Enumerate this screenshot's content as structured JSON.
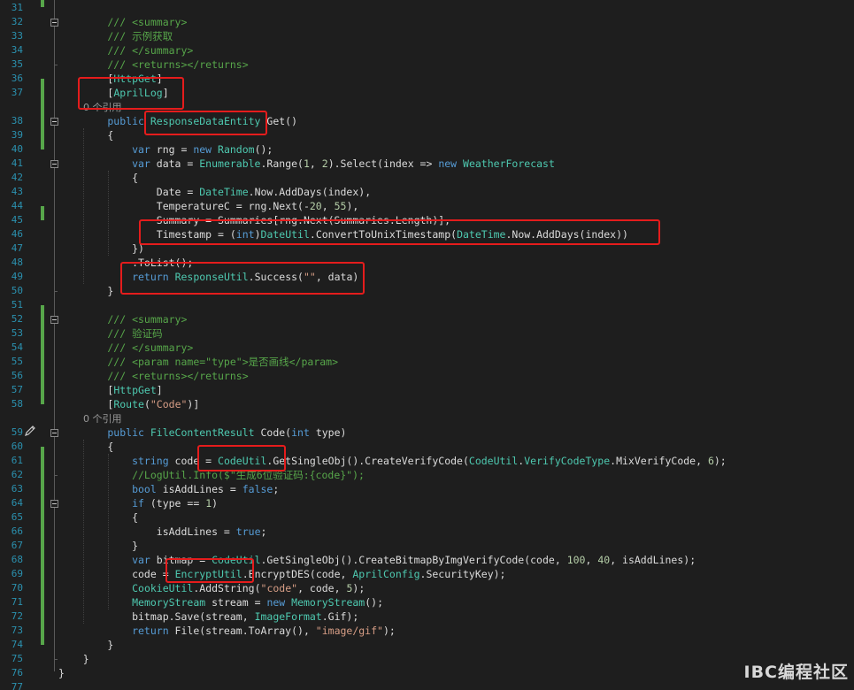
{
  "editor": {
    "lines": [
      {
        "n": "31",
        "segs": []
      },
      {
        "n": "32",
        "segs": [
          [
            "cm",
            "        /// <summary>"
          ]
        ]
      },
      {
        "n": "33",
        "segs": [
          [
            "cm",
            "        /// 示例获取"
          ]
        ]
      },
      {
        "n": "34",
        "segs": [
          [
            "cm",
            "        /// </summary>"
          ]
        ]
      },
      {
        "n": "35",
        "segs": [
          [
            "cm",
            "        /// <returns></returns>"
          ]
        ]
      },
      {
        "n": "36",
        "segs": [
          [
            "",
            "        ["
          ],
          [
            "attr",
            "HttpGet"
          ],
          [
            "",
            "]"
          ]
        ]
      },
      {
        "n": "37",
        "segs": [
          [
            "",
            "        ["
          ],
          [
            "attr",
            "AprilLog"
          ],
          [
            "",
            "]"
          ]
        ]
      },
      {
        "n": "",
        "segs": [
          [
            "ref",
            "        0 个引用"
          ]
        ]
      },
      {
        "n": "38",
        "segs": [
          [
            "kw",
            "        public "
          ],
          [
            "ty",
            "ResponseDataEntity"
          ],
          [
            "",
            " Get()"
          ]
        ]
      },
      {
        "n": "39",
        "segs": [
          [
            "",
            "        {"
          ]
        ]
      },
      {
        "n": "40",
        "segs": [
          [
            "kw",
            "            var"
          ],
          [
            "",
            " rng = "
          ],
          [
            "kw",
            "new "
          ],
          [
            "ty",
            "Random"
          ],
          [
            "",
            "();"
          ]
        ]
      },
      {
        "n": "41",
        "segs": [
          [
            "kw",
            "            var"
          ],
          [
            "",
            " data = "
          ],
          [
            "ty",
            "Enumerable"
          ],
          [
            "",
            ".Range("
          ],
          [
            "nm",
            "1"
          ],
          [
            "",
            ", "
          ],
          [
            "nm",
            "2"
          ],
          [
            "",
            ").Select(index => "
          ],
          [
            "kw",
            "new "
          ],
          [
            "ty",
            "WeatherForecast"
          ]
        ]
      },
      {
        "n": "42",
        "segs": [
          [
            "",
            "            {"
          ]
        ]
      },
      {
        "n": "43",
        "segs": [
          [
            "",
            "                Date = "
          ],
          [
            "ty",
            "DateTime"
          ],
          [
            "",
            ".Now.AddDays(index),"
          ]
        ]
      },
      {
        "n": "44",
        "segs": [
          [
            "",
            "                TemperatureC = rng.Next(-"
          ],
          [
            "nm",
            "20"
          ],
          [
            "",
            ", "
          ],
          [
            "nm",
            "55"
          ],
          [
            "",
            "),"
          ]
        ]
      },
      {
        "n": "45",
        "segs": [
          [
            "",
            "                Summary = Summaries[rng.Next(Summaries.Length)],"
          ]
        ]
      },
      {
        "n": "46",
        "segs": [
          [
            "",
            "                Timestamp = ("
          ],
          [
            "kw",
            "int"
          ],
          [
            "",
            ")"
          ],
          [
            "ty",
            "DateUtil"
          ],
          [
            "",
            ".ConvertToUnixTimestamp("
          ],
          [
            "ty",
            "DateTime"
          ],
          [
            "",
            ".Now.AddDays(index))"
          ]
        ]
      },
      {
        "n": "47",
        "segs": [
          [
            "",
            "            })"
          ]
        ]
      },
      {
        "n": "48",
        "segs": [
          [
            "",
            "            .ToList();"
          ]
        ]
      },
      {
        "n": "49",
        "segs": [
          [
            "kw",
            "            return "
          ],
          [
            "ty",
            "ResponseUtil"
          ],
          [
            "",
            ".Success("
          ],
          [
            "st",
            "\"\""
          ],
          [
            "",
            ", data)"
          ]
        ]
      },
      {
        "n": "50",
        "segs": [
          [
            "",
            "        }"
          ]
        ]
      },
      {
        "n": "51",
        "segs": []
      },
      {
        "n": "52",
        "segs": [
          [
            "cm",
            "        /// <summary>"
          ]
        ]
      },
      {
        "n": "53",
        "segs": [
          [
            "cm",
            "        /// 验证码"
          ]
        ]
      },
      {
        "n": "54",
        "segs": [
          [
            "cm",
            "        /// </summary>"
          ]
        ]
      },
      {
        "n": "55",
        "segs": [
          [
            "cm",
            "        /// <param name=\"type\">是否画线</param>"
          ]
        ]
      },
      {
        "n": "56",
        "segs": [
          [
            "cm",
            "        /// <returns></returns>"
          ]
        ]
      },
      {
        "n": "57",
        "segs": [
          [
            "",
            "        ["
          ],
          [
            "attr",
            "HttpGet"
          ],
          [
            "",
            "]"
          ]
        ]
      },
      {
        "n": "58",
        "segs": [
          [
            "",
            "        ["
          ],
          [
            "attr",
            "Route"
          ],
          [
            "",
            "("
          ],
          [
            "st",
            "\"Code\""
          ],
          [
            "",
            ")]"
          ]
        ]
      },
      {
        "n": "",
        "segs": [
          [
            "ref",
            "        0 个引用"
          ]
        ]
      },
      {
        "n": "59",
        "segs": [
          [
            "kw",
            "        public "
          ],
          [
            "ty",
            "FileContentResult"
          ],
          [
            "",
            " Code("
          ],
          [
            "kw",
            "int"
          ],
          [
            "",
            " type)"
          ]
        ]
      },
      {
        "n": "60",
        "segs": [
          [
            "",
            "        {"
          ]
        ]
      },
      {
        "n": "61",
        "segs": [
          [
            "kw",
            "            string"
          ],
          [
            "",
            " code = "
          ],
          [
            "ty",
            "CodeUtil"
          ],
          [
            "",
            ".GetSingleObj().CreateVerifyCode("
          ],
          [
            "ty",
            "CodeUtil"
          ],
          [
            "",
            "."
          ],
          [
            "ty",
            "VerifyCodeType"
          ],
          [
            "",
            ".MixVerifyCode, "
          ],
          [
            "nm",
            "6"
          ],
          [
            "",
            ");"
          ]
        ]
      },
      {
        "n": "62",
        "segs": [
          [
            "cm",
            "            //LogUtil.Info($\"生成6位验证码:{code}\");"
          ]
        ]
      },
      {
        "n": "63",
        "segs": [
          [
            "kw",
            "            bool"
          ],
          [
            "",
            " isAddLines = "
          ],
          [
            "kw",
            "false"
          ],
          [
            "",
            ";"
          ]
        ]
      },
      {
        "n": "64",
        "segs": [
          [
            "kw",
            "            if"
          ],
          [
            "",
            " (type == "
          ],
          [
            "nm",
            "1"
          ],
          [
            "",
            ")"
          ]
        ]
      },
      {
        "n": "65",
        "segs": [
          [
            "",
            "            {"
          ]
        ]
      },
      {
        "n": "66",
        "segs": [
          [
            "",
            "                isAddLines = "
          ],
          [
            "kw",
            "true"
          ],
          [
            "",
            ";"
          ]
        ]
      },
      {
        "n": "67",
        "segs": [
          [
            "",
            "            }"
          ]
        ]
      },
      {
        "n": "68",
        "segs": [
          [
            "kw",
            "            var"
          ],
          [
            "",
            " bitmap = "
          ],
          [
            "ty",
            "CodeUtil"
          ],
          [
            "",
            ".GetSingleObj().CreateBitmapByImgVerifyCode(code, "
          ],
          [
            "nm",
            "100"
          ],
          [
            "",
            ", "
          ],
          [
            "nm",
            "40"
          ],
          [
            "",
            ", isAddLines);"
          ]
        ]
      },
      {
        "n": "69",
        "segs": [
          [
            "",
            "            code = "
          ],
          [
            "ty",
            "EncryptUtil"
          ],
          [
            "",
            ".EncryptDES(code, "
          ],
          [
            "ty",
            "AprilConfig"
          ],
          [
            "",
            ".SecurityKey);"
          ]
        ]
      },
      {
        "n": "70",
        "segs": [
          [
            "",
            "            "
          ],
          [
            "ty",
            "CookieUtil"
          ],
          [
            "",
            ".AddString("
          ],
          [
            "st",
            "\"code\""
          ],
          [
            "",
            ", code, "
          ],
          [
            "nm",
            "5"
          ],
          [
            "",
            ");"
          ]
        ]
      },
      {
        "n": "71",
        "segs": [
          [
            "",
            "            "
          ],
          [
            "ty",
            "MemoryStream"
          ],
          [
            "",
            " stream = "
          ],
          [
            "kw",
            "new "
          ],
          [
            "ty",
            "MemoryStream"
          ],
          [
            "",
            "();"
          ]
        ]
      },
      {
        "n": "72",
        "segs": [
          [
            "",
            "            bitmap.Save(stream, "
          ],
          [
            "ty",
            "ImageFormat"
          ],
          [
            "",
            ".Gif);"
          ]
        ]
      },
      {
        "n": "73",
        "segs": [
          [
            "kw",
            "            return"
          ],
          [
            "",
            " File(stream.ToArray(), "
          ],
          [
            "st",
            "\"image/gif\""
          ],
          [
            "",
            ");"
          ]
        ]
      },
      {
        "n": "74",
        "segs": [
          [
            "",
            "        }"
          ]
        ]
      },
      {
        "n": "75",
        "segs": [
          [
            "",
            "    }"
          ]
        ]
      },
      {
        "n": "76",
        "segs": [
          [
            "",
            "}"
          ]
        ]
      },
      {
        "n": "77",
        "segs": []
      }
    ]
  },
  "gutter": {
    "pencil_icon": "pencil-icon",
    "fold_icon": "collapse-box-icon"
  },
  "watermark": {
    "text": "IBC编程社区"
  },
  "colors": {
    "background": "#1e1e1e",
    "keyword": "#569cd6",
    "type": "#4ec9b0",
    "comment": "#57a64a",
    "string": "#d69d85",
    "number": "#b5cea8",
    "line_number": "#2b91af",
    "highlight_box": "#e51c1c"
  }
}
